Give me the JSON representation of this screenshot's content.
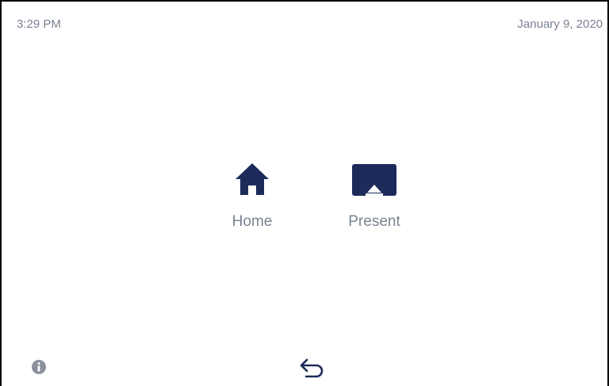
{
  "status_bar": {
    "time": "3:29 PM",
    "date": "January 9, 2020"
  },
  "tiles": [
    {
      "label": "Home",
      "icon": "home-icon"
    },
    {
      "label": "Present",
      "icon": "airplay-present-icon"
    }
  ],
  "footer": {
    "info_icon": "info-icon",
    "back_icon": "back-arrow-icon"
  },
  "colors": {
    "icon_navy": "#1c2b5a",
    "label_gray": "#7a8292",
    "info_gray": "#8a909c"
  }
}
